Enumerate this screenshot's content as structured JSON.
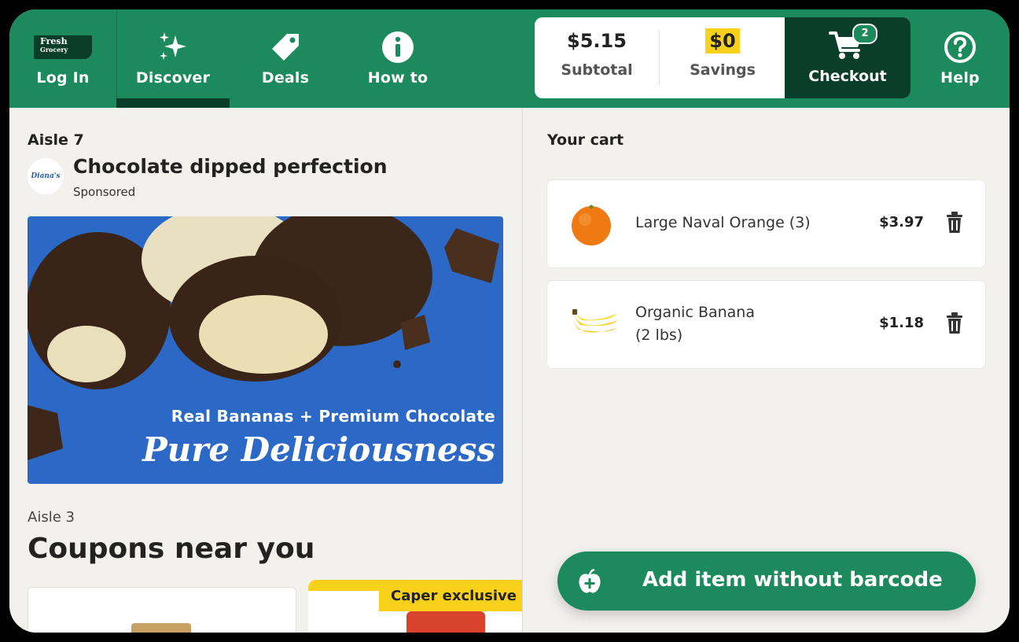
{
  "nav": {
    "login": {
      "label": "Log In",
      "logo_line1": "Fresh",
      "logo_line2": "Grocery"
    },
    "discover": {
      "label": "Discover"
    },
    "deals": {
      "label": "Deals"
    },
    "howto": {
      "label": "How to"
    },
    "help": {
      "label": "Help"
    }
  },
  "summary": {
    "subtotal_value": "$5.15",
    "subtotal_label": "Subtotal",
    "savings_value": "$0",
    "savings_label": "Savings",
    "checkout_label": "Checkout",
    "cart_count": "2"
  },
  "left": {
    "aisle_label": "Aisle 7",
    "brand_logo": "Diana's",
    "promo_title": "Chocolate dipped perfection",
    "sponsored": "Sponsored",
    "banner_line1": "Real Bananas + Premium Chocolate",
    "banner_line2": "Pure Deliciousness",
    "aisle2_label": "Aisle 3",
    "coupons_title": "Coupons near you",
    "caper_badge": "Caper exclusive"
  },
  "cart": {
    "title": "Your cart",
    "items": [
      {
        "name": "Large Naval Orange (3)",
        "price": "$3.97",
        "icon": "orange-icon"
      },
      {
        "name_line1": "Organic Banana",
        "name_line2": "(2 lbs)",
        "price": "$1.18",
        "icon": "banana-icon"
      }
    ],
    "add_button": "Add item without barcode"
  },
  "colors": {
    "brand_green": "#1d8a5d",
    "dark_green": "#0b3e2a",
    "savings_yellow": "#f9d11b",
    "banner_blue": "#2c69c6"
  }
}
